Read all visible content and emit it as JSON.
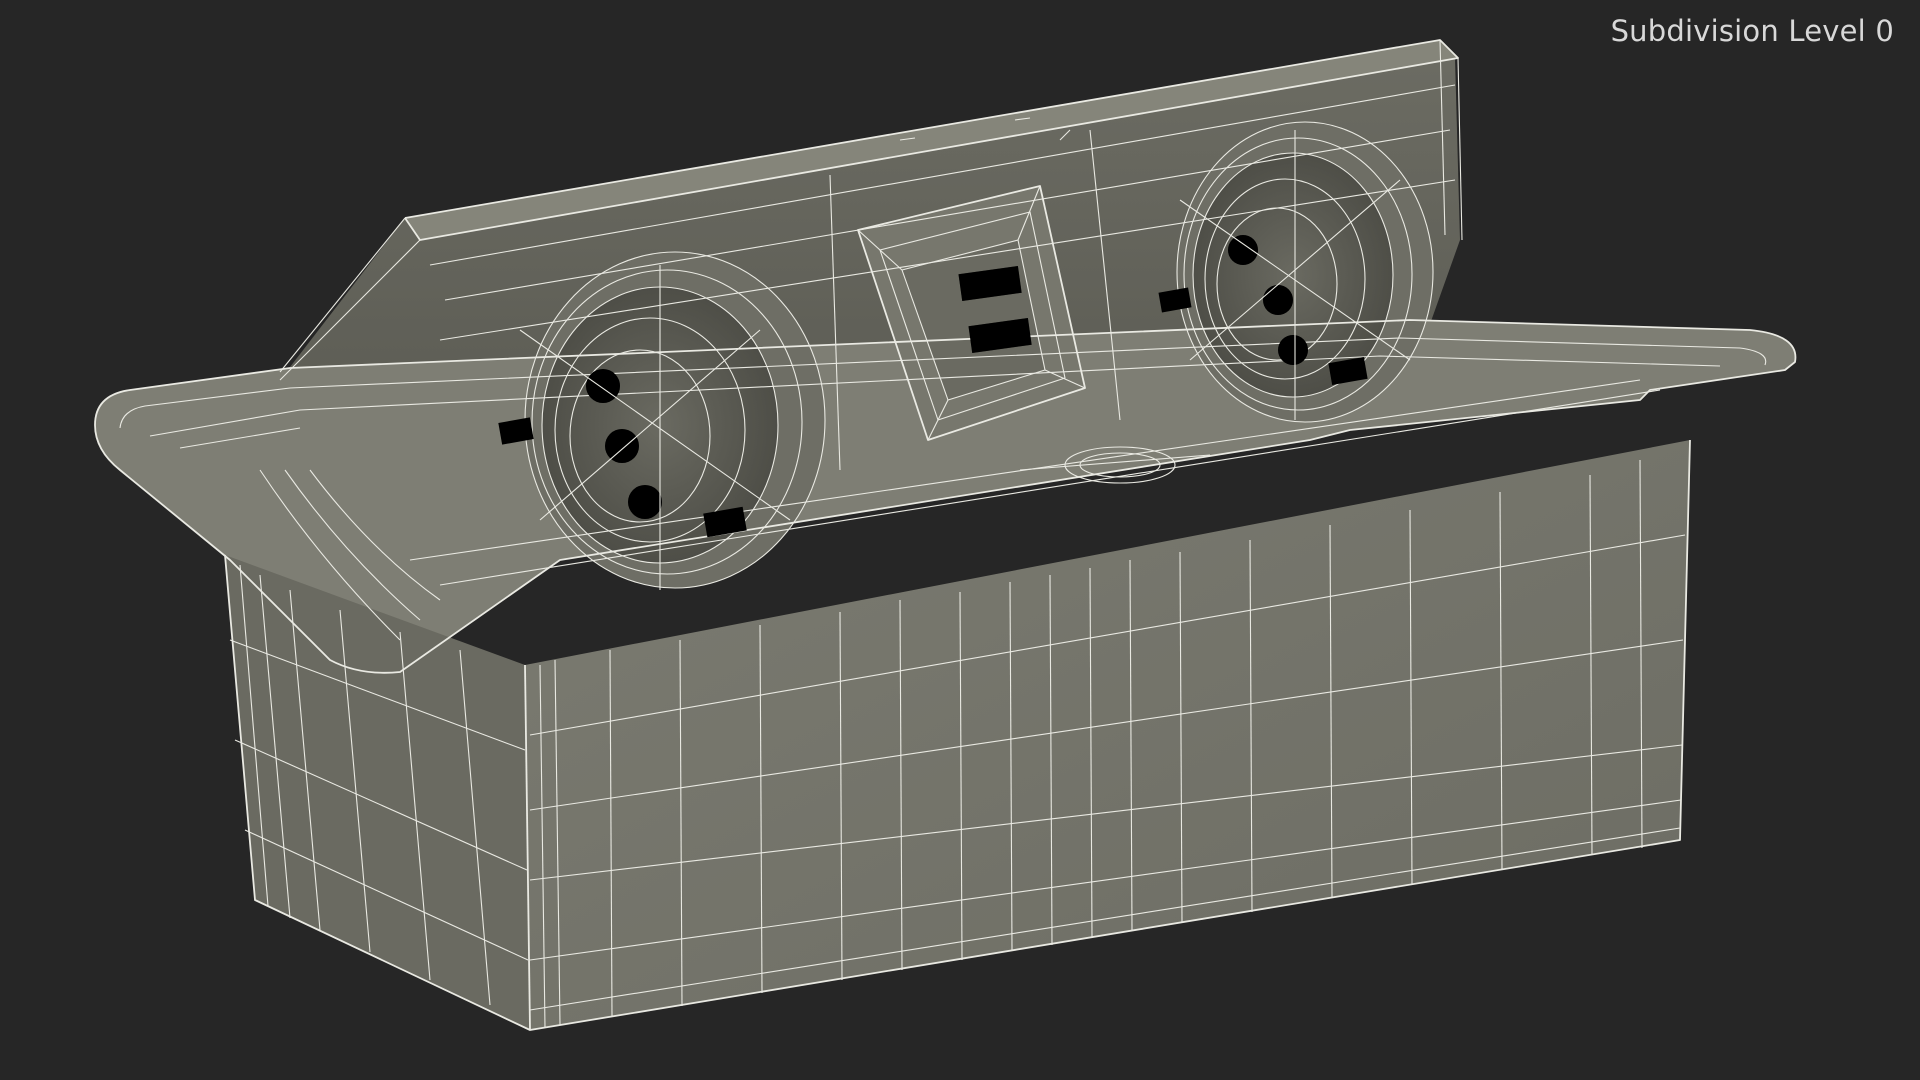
{
  "viewport": {
    "overlay_label": "Subdivision Level 0",
    "background_color": "#262626",
    "model_color": "#76766c",
    "wire_color": "#e9e9e2"
  }
}
